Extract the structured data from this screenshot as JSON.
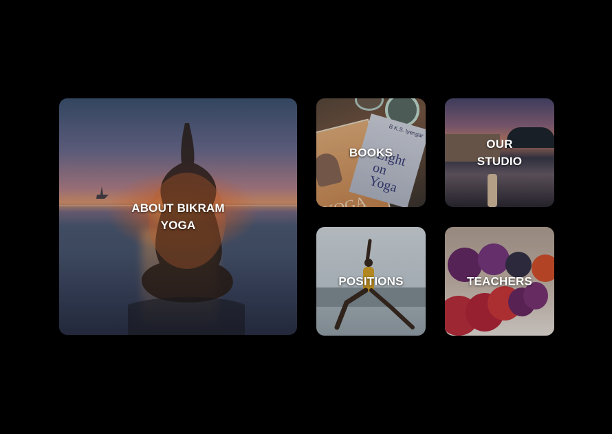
{
  "tiles": [
    {
      "id": "about",
      "label": "ABOUT BIKRAM\nYOGA"
    },
    {
      "id": "books",
      "label": "BOOKS"
    },
    {
      "id": "studio",
      "label": "OUR\nSTUDIO"
    },
    {
      "id": "positions",
      "label": "POSITIONS"
    },
    {
      "id": "teachers",
      "label": "TEACHERS"
    }
  ],
  "books_tile": {
    "book_author": "B.K.S. Iyengar",
    "book_title": "Light on Yoga",
    "book_cover_word": "YOGA"
  },
  "colors": {
    "background": "#000000",
    "label": "#ffffff"
  }
}
